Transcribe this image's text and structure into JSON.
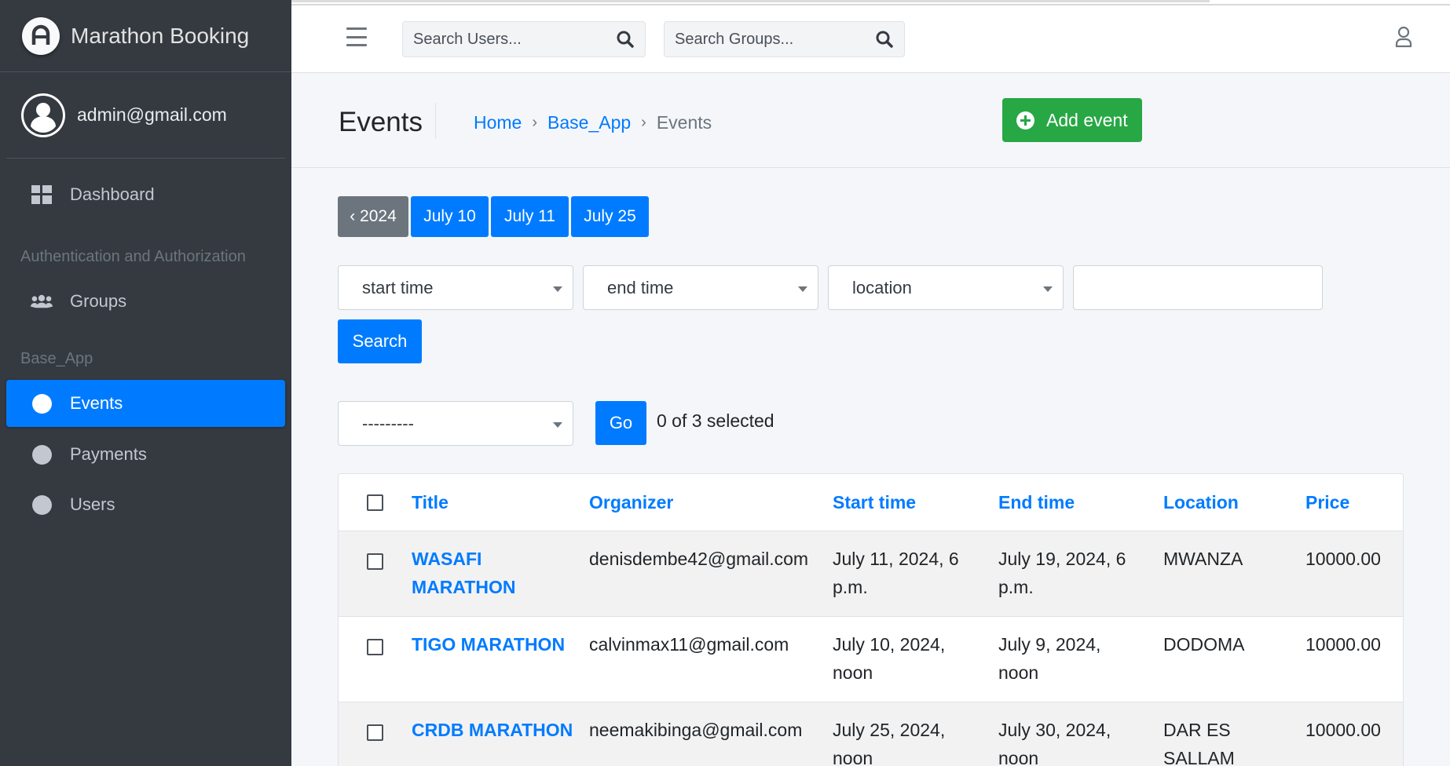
{
  "sidebar": {
    "brand": "Marathon Booking",
    "user": "admin@gmail.com",
    "dashboard": "Dashboard",
    "section_auth": "Authentication and Authorization",
    "groups": "Groups",
    "section_app": "Base_App",
    "events": "Events",
    "payments": "Payments",
    "users": "Users"
  },
  "topbar": {
    "search_users": "Search Users...",
    "search_groups": "Search Groups..."
  },
  "header": {
    "title": "Events",
    "breadcrumb": [
      "Home",
      "Base_App",
      "Events"
    ],
    "add_button": "Add event"
  },
  "date_hierarchy": {
    "back": "‹ 2024",
    "days": [
      "July 10",
      "July 11",
      "July 25"
    ]
  },
  "filters": {
    "start_time": "start time",
    "end_time": "end time",
    "location": "location",
    "search_button": "Search"
  },
  "actions": {
    "select_value": "---------",
    "go_button": "Go",
    "selected_count": "0 of 3 selected"
  },
  "table": {
    "headers": [
      "Title",
      "Organizer",
      "Start time",
      "End time",
      "Location",
      "Price"
    ],
    "rows": [
      {
        "title": [
          "WASAFI",
          "MARATHON"
        ],
        "organizer": "denisdembe42@gmail.com",
        "start": [
          "July 11, 2024, 6",
          "p.m."
        ],
        "end": [
          "July 19, 2024, 6",
          "p.m."
        ],
        "location": [
          "MWANZA",
          ""
        ],
        "price": "10000.00"
      },
      {
        "title": [
          "TIGO MARATHON",
          ""
        ],
        "organizer": "calvinmax11@gmail.com",
        "start": [
          "July 10, 2024,",
          "noon"
        ],
        "end": [
          "July 9, 2024,",
          "noon"
        ],
        "location": [
          "DODOMA",
          ""
        ],
        "price": "10000.00"
      },
      {
        "title": [
          "CRDB MARATHON",
          ""
        ],
        "organizer": "neemakibinga@gmail.com",
        "start": [
          "July 25, 2024,",
          "noon"
        ],
        "end": [
          "July 30, 2024,",
          "noon"
        ],
        "location": [
          "DAR ES",
          "SALLAM"
        ],
        "price": "10000.00"
      }
    ]
  }
}
